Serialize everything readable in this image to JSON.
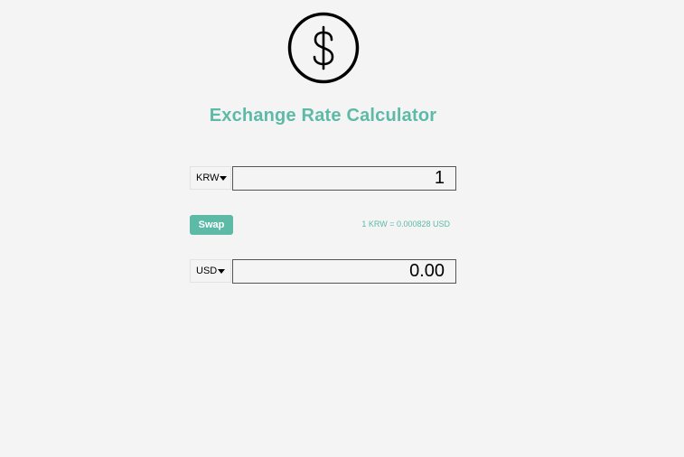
{
  "app": {
    "title": "Exchange Rate Calculator",
    "logo_icon": "dollar-sign-circle-icon"
  },
  "from": {
    "currency": "KRW",
    "amount": "1"
  },
  "swap": {
    "label": "Swap",
    "rate_text": "1 KRW = 0.000828 USD"
  },
  "to": {
    "currency": "USD",
    "amount": "0.00"
  },
  "colors": {
    "accent": "#5cbaa7",
    "background": "#f4f4f4"
  }
}
